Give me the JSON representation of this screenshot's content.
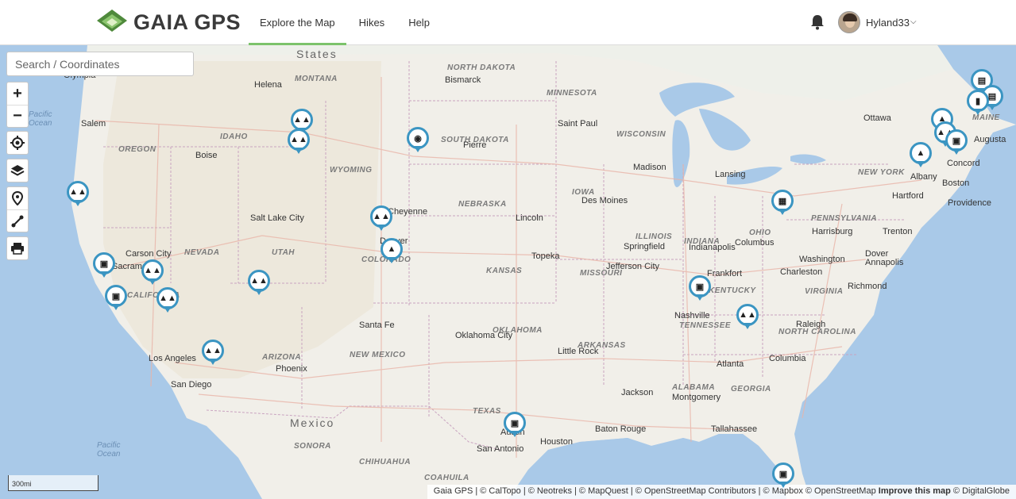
{
  "header": {
    "brand": "GAIA GPS",
    "nav": [
      "Explore the Map",
      "Hikes",
      "Help"
    ],
    "user": "Hyland33"
  },
  "search": {
    "placeholder": "Search / Coordinates"
  },
  "controls": {
    "zoom_in": "+",
    "zoom_out": "−"
  },
  "map": {
    "country_labels": [
      "States",
      "Mexico"
    ],
    "ocean_labels": [
      [
        "Pacific",
        "Ocean"
      ],
      [
        "Pacific",
        "Ocean"
      ]
    ],
    "state_labels": [
      "NORTH DAKOTA",
      "MONTANA",
      "MINNESOTA",
      "IDAHO",
      "SOUTH DAKOTA",
      "WISCONSIN",
      "OREGON",
      "WYOMING",
      "NEW YORK",
      "MAINE",
      "IOWA",
      "NEBRASKA",
      "PENNSYLVANIA",
      "NEVADA",
      "UTAH",
      "COLORADO",
      "ILLINOIS",
      "INDIANA",
      "OHIO",
      "KANSAS",
      "MISSOURI",
      "CALIFORNIA",
      "KENTUCKY",
      "VIRGINIA",
      "TENNESSEE",
      "NORTH CAROLINA",
      "OKLAHOMA",
      "ARKANSAS",
      "ARIZONA",
      "NEW MEXICO",
      "ALABAMA",
      "GEORGIA",
      "TEXAS",
      "SONORA",
      "CHIHUAHUA",
      "COAHUILA"
    ],
    "city_labels": [
      "Olympia",
      "Helena",
      "Bismarck",
      "Salem",
      "Saint Paul",
      "Ottawa",
      "Augusta",
      "Pierre",
      "Boise",
      "Madison",
      "Lansing",
      "Concord",
      "Albany",
      "Boston",
      "Hartford",
      "Providence",
      "Salt Lake City",
      "Cheyenne",
      "Des Moines",
      "Lincoln",
      "Harrisburg",
      "Trenton",
      "Carson City",
      "Sacramento",
      "Denver",
      "Springfield",
      "Indianapolis",
      "Columbus",
      "Topeka",
      "Dover",
      "Annapolis",
      "Washington",
      "Jefferson City",
      "Frankfort",
      "Charleston",
      "Richmond",
      "Nashville",
      "Raleigh",
      "Santa Fe",
      "Oklahoma City",
      "Little Rock",
      "Los Angeles",
      "Phoenix",
      "San Diego",
      "Atlanta",
      "Columbia",
      "Jackson",
      "Montgomery",
      "Austin",
      "Houston",
      "Baton Rouge",
      "Tallahassee",
      "San Antonio"
    ],
    "scale": "300mi",
    "attribution_parts": [
      "Gaia GPS | © CalTopo | © Neotreks | © MapQuest | © OpenStreetMap Contributors | © Mapbox © OpenStreetMap ",
      "Improve this map",
      " © DigitalGlobe"
    ]
  },
  "colors": {
    "accent": "#7cc36b",
    "pin": "#3b95c2",
    "water": "#a9c9e8",
    "land": "#f4f2ee"
  },
  "pin_icons": [
    "tree-icon",
    "car-icon",
    "camera-icon",
    "tent-icon",
    "building-icon",
    "bus-icon",
    "gas-icon"
  ]
}
